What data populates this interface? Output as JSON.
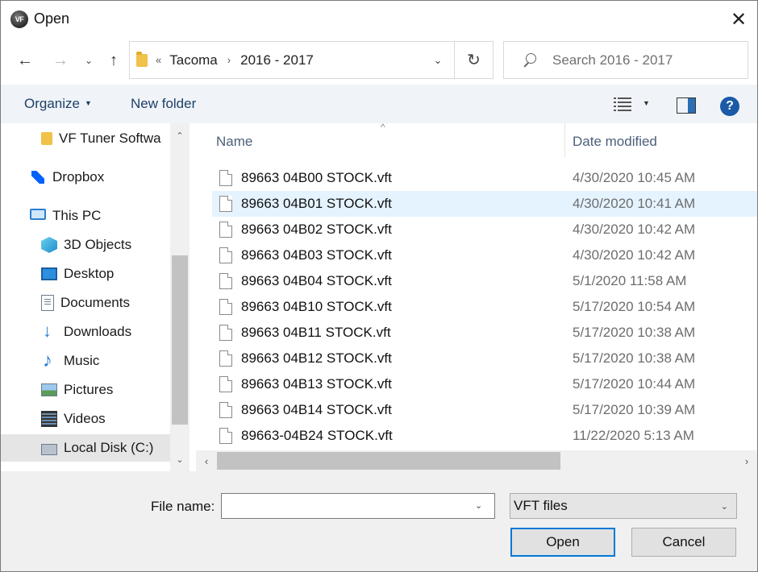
{
  "window": {
    "title": "Open",
    "app_icon_text": "VF",
    "close_glyph": "✕"
  },
  "nav": {
    "back_glyph": "←",
    "forward_glyph": "→",
    "recent_glyph": "⌄",
    "up_glyph": "↑"
  },
  "address": {
    "overflow_glyph": "«",
    "crumbs": [
      "Tacoma",
      "2016 - 2017"
    ],
    "separator": "›",
    "dropdown_glyph": "⌄",
    "refresh_glyph": "↻"
  },
  "search": {
    "placeholder": "Search 2016 - 2017"
  },
  "toolbar": {
    "organize_label": "Organize",
    "organize_caret": "▼",
    "new_folder_label": "New folder",
    "view_caret": "▼",
    "help_label": "?"
  },
  "navpane": {
    "items": [
      {
        "label": "VF Tuner Softwa",
        "icon": "folder-icon"
      },
      {
        "label": "Dropbox",
        "icon": "dropbox-icon"
      },
      {
        "label": "This PC",
        "icon": "this-pc-icon"
      },
      {
        "label": "3D Objects",
        "icon": "3d-objects-icon"
      },
      {
        "label": "Desktop",
        "icon": "desktop-icon"
      },
      {
        "label": "Documents",
        "icon": "documents-icon"
      },
      {
        "label": "Downloads",
        "icon": "downloads-icon"
      },
      {
        "label": "Music",
        "icon": "music-icon"
      },
      {
        "label": "Pictures",
        "icon": "pictures-icon"
      },
      {
        "label": "Videos",
        "icon": "videos-icon"
      },
      {
        "label": "Local Disk (C:)",
        "icon": "local-disk-icon"
      }
    ],
    "scroll_up_glyph": "⌃",
    "scroll_down_glyph": "⌄"
  },
  "filelist": {
    "columns": {
      "name": "Name",
      "date": "Date modified"
    },
    "sort_glyph": "^",
    "files": [
      {
        "name": "89663 04B00 STOCK.vft",
        "date": "4/30/2020 10:45 AM"
      },
      {
        "name": "89663 04B01 STOCK.vft",
        "date": "4/30/2020 10:41 AM"
      },
      {
        "name": "89663 04B02 STOCK.vft",
        "date": "4/30/2020 10:42 AM"
      },
      {
        "name": "89663 04B03 STOCK.vft",
        "date": "4/30/2020 10:42 AM"
      },
      {
        "name": "89663 04B04 STOCK.vft",
        "date": "5/1/2020 11:58 AM"
      },
      {
        "name": "89663 04B10 STOCK.vft",
        "date": "5/17/2020 10:54 AM"
      },
      {
        "name": "89663 04B11 STOCK.vft",
        "date": "5/17/2020 10:38 AM"
      },
      {
        "name": "89663 04B12 STOCK.vft",
        "date": "5/17/2020 10:38 AM"
      },
      {
        "name": "89663 04B13 STOCK.vft",
        "date": "5/17/2020 10:44 AM"
      },
      {
        "name": "89663 04B14 STOCK.vft",
        "date": "5/17/2020 10:39 AM"
      },
      {
        "name": "89663-04B24 STOCK.vft",
        "date": "11/22/2020 5:13 AM"
      }
    ],
    "hscroll_left_glyph": "‹",
    "hscroll_right_glyph": "›"
  },
  "bottom": {
    "file_name_label": "File name:",
    "file_name_value": "",
    "file_name_caret": "⌄",
    "file_type_value": "VFT files",
    "file_type_caret": "⌄",
    "open_label": "Open",
    "cancel_label": "Cancel"
  }
}
